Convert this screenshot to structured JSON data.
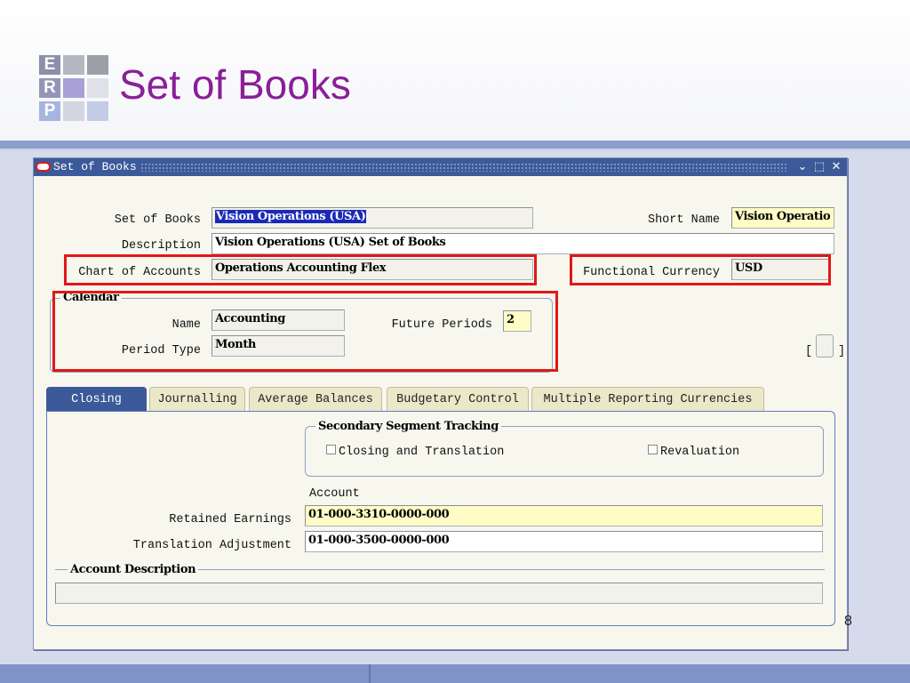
{
  "slide": {
    "title": "Set of Books",
    "page_number": "8",
    "logo_letters": [
      "E",
      "R",
      "P"
    ]
  },
  "window": {
    "title": "Set of Books",
    "controls": {
      "minimize": "⌄",
      "maximize": "⬚",
      "close": "✕"
    }
  },
  "header": {
    "set_of_books": {
      "label": "Set of Books",
      "value": "Vision Operations (USA)"
    },
    "short_name": {
      "label": "Short Name",
      "value": "Vision Operatio"
    },
    "description": {
      "label": "Description",
      "value": "Vision Operations (USA) Set of Books"
    },
    "chart_of_accounts": {
      "label": "Chart of Accounts",
      "value": "Operations Accounting Flex"
    },
    "functional_currency": {
      "label": "Functional Currency",
      "value": "USD"
    }
  },
  "calendar": {
    "group_label": "Calendar",
    "name": {
      "label": "Name",
      "value": "Accounting"
    },
    "future_periods": {
      "label": "Future Periods",
      "value": "2"
    },
    "period_type": {
      "label": "Period Type",
      "value": "Month"
    },
    "descriptive_flex": {
      "open": "[",
      "close": "]"
    }
  },
  "tabs": [
    {
      "label": "Closing",
      "active": true
    },
    {
      "label": "Journalling",
      "active": false
    },
    {
      "label": "Average Balances",
      "active": false
    },
    {
      "label": "Budgetary Control",
      "active": false
    },
    {
      "label": "Multiple Reporting Currencies",
      "active": false
    }
  ],
  "closing": {
    "secondary_segment_tracking": {
      "group_label": "Secondary Segment Tracking",
      "closing_and_translation": {
        "label": "Closing and Translation",
        "checked": false
      },
      "revaluation": {
        "label": "Revaluation",
        "checked": false
      }
    },
    "account_header": "Account",
    "retained_earnings": {
      "label": "Retained Earnings",
      "value": "01-000-3310-0000-000"
    },
    "translation_adjustment": {
      "label": "Translation Adjustment",
      "value": "01-000-3500-0000-000"
    },
    "account_description": {
      "label": "Account Description",
      "value": ""
    }
  },
  "colors": {
    "title_purple": "#8a1f98",
    "window_titlebar": "#3c5a99",
    "highlight_red": "#e01818",
    "required_yellow": "#fffcc6"
  }
}
